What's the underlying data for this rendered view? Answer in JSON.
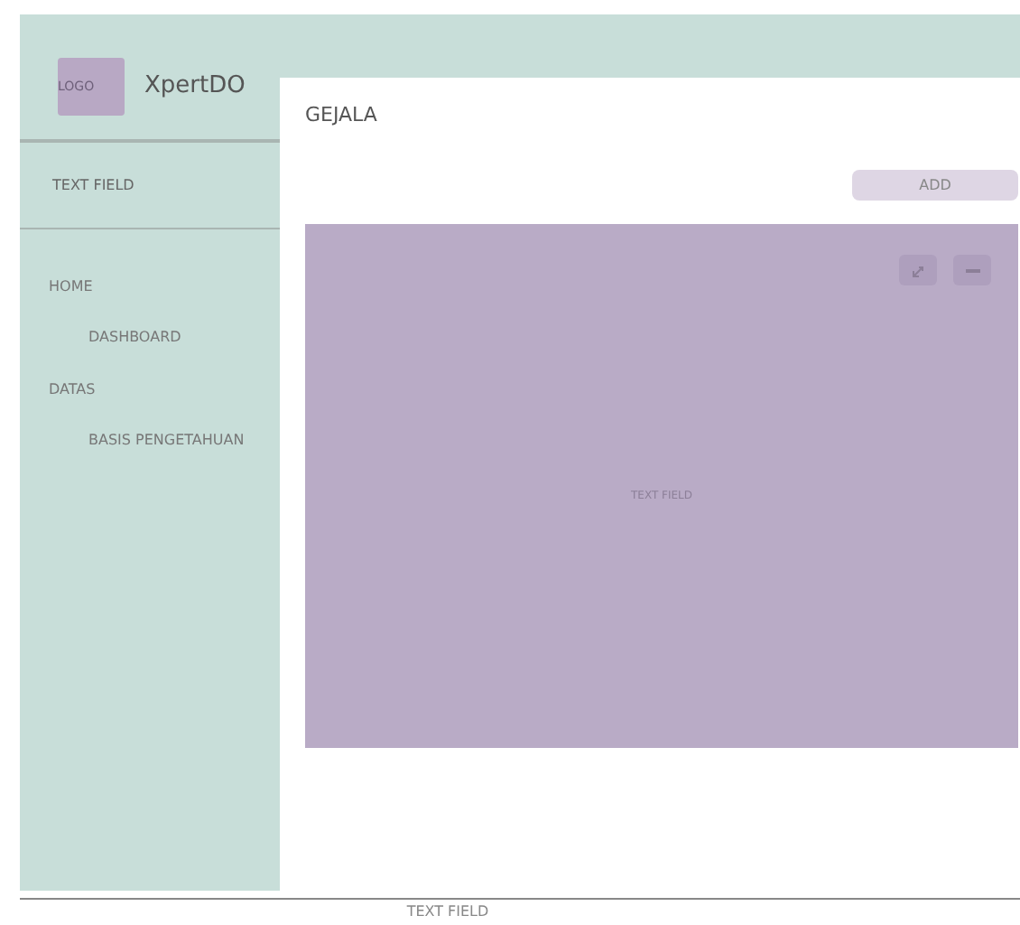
{
  "sidebar": {
    "logo": "LOGO",
    "brand": "XpertDO",
    "field": "TEXT FIELD",
    "items": [
      {
        "label": "HOME",
        "children": [
          {
            "label": "DASHBOARD"
          }
        ]
      },
      {
        "label": "DATAS",
        "children": [
          {
            "label": "BASIS PENGETAHUAN"
          }
        ]
      }
    ]
  },
  "page": {
    "title": "GEJALA",
    "add_button": "ADD",
    "panel_text": "TEXT FIELD"
  },
  "footer": "TEXT FIELD"
}
